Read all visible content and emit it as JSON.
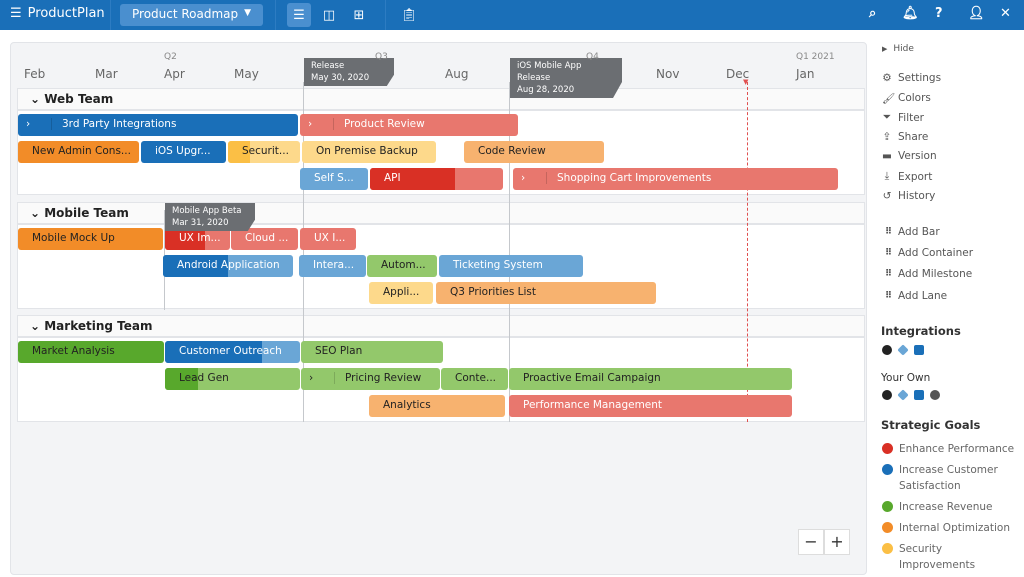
{
  "header": {
    "brand": "ProductPlan",
    "roadmap_select": "Product Roadmap",
    "icons": [
      "bars-view-icon",
      "columns-view-icon",
      "table-view-icon",
      "clipboard-icon",
      "search-icon",
      "bell-icon",
      "help-icon",
      "user-icon",
      "fullscreen-icon"
    ]
  },
  "timeline": {
    "months": [
      "Feb",
      "Mar",
      "Apr",
      "May",
      "Aug",
      "Nov",
      "Dec",
      "Jan"
    ],
    "quarters": [
      "Q2",
      "Q3",
      "Q4",
      "Q1 2021"
    ],
    "milestones": [
      {
        "title": "Release",
        "date": "May 30, 2020"
      },
      {
        "title": "iOS Mobile App Release",
        "date": "Aug 28, 2020"
      },
      {
        "title": "Mobile App Beta",
        "date": "Mar 31, 2020"
      }
    ]
  },
  "lanes": [
    {
      "name": "Web Team"
    },
    {
      "name": "Mobile Team"
    },
    {
      "name": "Marketing Team"
    }
  ],
  "colors": {
    "blue": "#1a6fb8",
    "light_blue": "#6aa6d6",
    "red": "#d93025",
    "light_red": "#e8776e",
    "orange": "#f28c28",
    "light_orange": "#f7b26f",
    "yellow": "#fbbf45",
    "light_yellow": "#fdd98b",
    "green": "#58a82c",
    "light_green": "#93c86b"
  },
  "bars": [
    {
      "label": "3rd Party Integrations",
      "color": "blue",
      "container": true
    },
    {
      "label": "Product Review",
      "color": "light_red",
      "container": true
    },
    {
      "label": "New Admin Cons...",
      "color": "orange"
    },
    {
      "label": "iOS Upgr...",
      "color": "blue"
    },
    {
      "label": "Securit...",
      "color": "light_yellow",
      "progress_color": "yellow"
    },
    {
      "label": "On Premise Backup",
      "color": "light_yellow"
    },
    {
      "label": "Code Review",
      "color": "light_orange"
    },
    {
      "label": "Self S...",
      "color": "light_blue"
    },
    {
      "label": "API",
      "color": "light_red",
      "progress_color": "red"
    },
    {
      "label": "Shopping Cart Improvements",
      "color": "light_red",
      "container": true
    },
    {
      "label": "Mobile Mock Up",
      "color": "orange"
    },
    {
      "label": "UX Im...",
      "color": "light_red",
      "progress_color": "red"
    },
    {
      "label": "Cloud ...",
      "color": "light_red"
    },
    {
      "label": "UX I...",
      "color": "light_red"
    },
    {
      "label": "Android Application",
      "color": "light_blue",
      "progress_color": "blue"
    },
    {
      "label": "Intera...",
      "color": "light_blue"
    },
    {
      "label": "Autom...",
      "color": "light_green"
    },
    {
      "label": "Ticketing System",
      "color": "light_blue"
    },
    {
      "label": "Appli...",
      "color": "light_yellow"
    },
    {
      "label": "Q3 Priorities List",
      "color": "light_orange"
    },
    {
      "label": "Market Analysis",
      "color": "green"
    },
    {
      "label": "Customer Outreach",
      "color": "light_blue",
      "progress_color": "blue"
    },
    {
      "label": "SEO Plan",
      "color": "light_green"
    },
    {
      "label": "Lead Gen",
      "color": "light_green",
      "progress_color": "green"
    },
    {
      "label": "Pricing Review",
      "color": "light_green",
      "container": true
    },
    {
      "label": "Conte...",
      "color": "light_green"
    },
    {
      "label": "Proactive Email Campaign",
      "color": "light_green"
    },
    {
      "label": "Analytics",
      "color": "light_orange"
    },
    {
      "label": "Performance Management",
      "color": "light_red"
    }
  ],
  "sidebar": {
    "hide": "Hide",
    "menu": [
      {
        "label": "Settings",
        "icon": "gear-icon"
      },
      {
        "label": "Colors",
        "icon": "brush-icon"
      },
      {
        "label": "Filter",
        "icon": "filter-icon"
      },
      {
        "label": "Share",
        "icon": "share-icon"
      },
      {
        "label": "Version",
        "icon": "archive-icon"
      },
      {
        "label": "Export",
        "icon": "download-icon"
      },
      {
        "label": "History",
        "icon": "history-icon"
      }
    ],
    "add": [
      {
        "label": "Add Bar"
      },
      {
        "label": "Add Container"
      },
      {
        "label": "Add Milestone"
      },
      {
        "label": "Add Lane"
      }
    ],
    "integrations_title": "Integrations",
    "your_own_title": "Your Own",
    "goals_title": "Strategic Goals",
    "goals": [
      {
        "label": "Enhance Performance",
        "color": "#d93025"
      },
      {
        "label": "Increase Customer Satisfaction",
        "color": "#1a6fb8"
      },
      {
        "label": "Increase Revenue",
        "color": "#58a82c"
      },
      {
        "label": "Internal Optimization",
        "color": "#f28c28"
      },
      {
        "label": "Security Improvements",
        "color": "#fbbf45"
      }
    ]
  },
  "zoom": {
    "out": "−",
    "in": "+"
  }
}
